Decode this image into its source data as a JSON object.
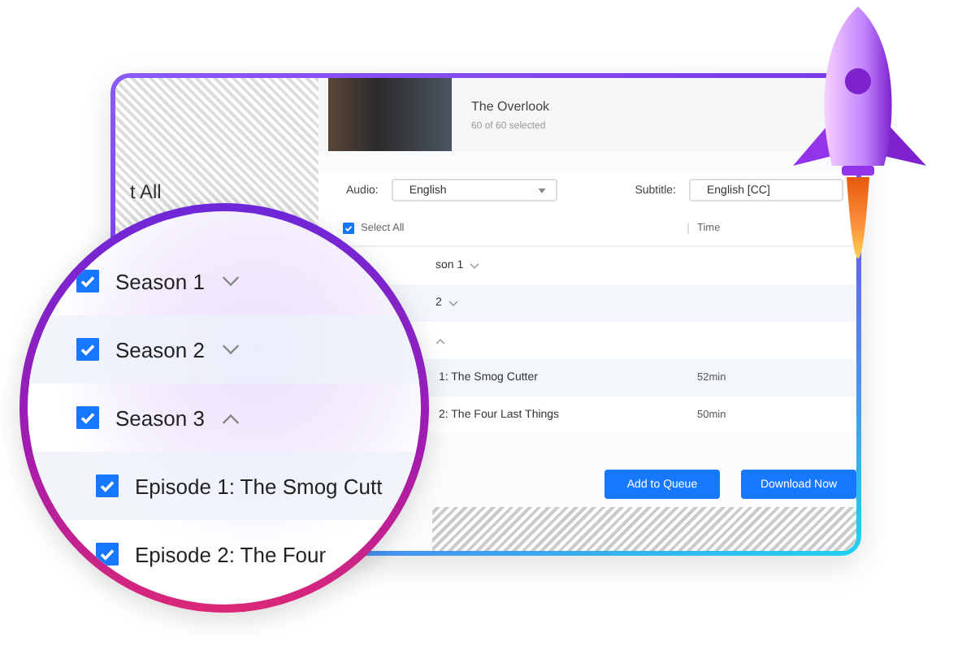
{
  "window": {
    "title": "The Overlook",
    "selection_count": "60 of 60 selected",
    "audio": {
      "label": "Audio:",
      "value": "English"
    },
    "subtitle": {
      "label": "Subtitle:",
      "value": "English [CC]"
    },
    "table": {
      "select_all": {
        "label": "Select All",
        "checked": true
      },
      "time_header": "Time",
      "rows": [
        {
          "kind": "season",
          "label": "son 1",
          "expanded": false
        },
        {
          "kind": "season",
          "label": "2",
          "expanded": false
        },
        {
          "kind": "season",
          "expanded": true
        },
        {
          "kind": "episode",
          "label": "1: The Smog Cutter",
          "time": "52min"
        },
        {
          "kind": "episode",
          "label": "2: The Four Last Things",
          "time": "50min"
        }
      ]
    },
    "buttons": [
      "Add to Queue",
      "Download Now"
    ]
  },
  "magnifier": {
    "fragment": "t All",
    "rows": [
      {
        "kind": "season",
        "label": "Season 1",
        "checked": true,
        "expanded": false
      },
      {
        "kind": "season",
        "label": "Season 2",
        "checked": true,
        "expanded": false
      },
      {
        "kind": "season",
        "label": "Season 3",
        "checked": true,
        "expanded": true
      },
      {
        "kind": "episode",
        "label": "Episode 1: The Smog Cutt",
        "checked": true
      },
      {
        "kind": "episode",
        "label": "Episode 2: The Four",
        "checked": true
      }
    ]
  }
}
